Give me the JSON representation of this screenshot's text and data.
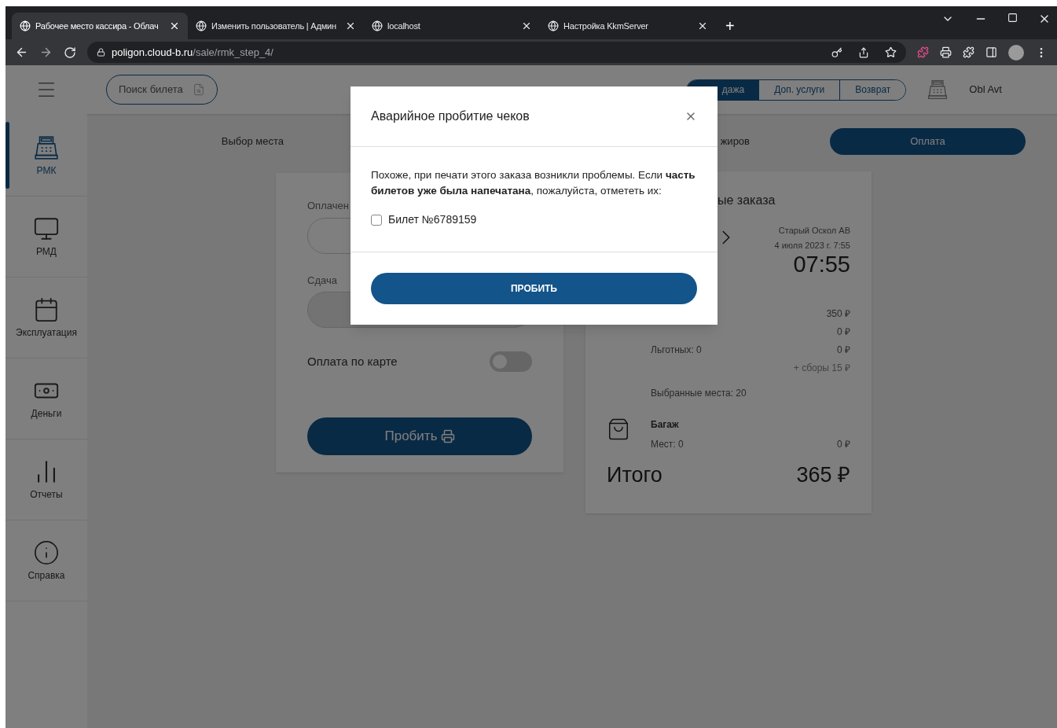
{
  "browser": {
    "tabs": [
      {
        "title": "Рабочее место кассира - Облач",
        "selected": true
      },
      {
        "title": "Изменить пользователь | Админ",
        "selected": false
      },
      {
        "title": "localhost",
        "selected": false
      },
      {
        "title": "Настройка KkmServer",
        "selected": false
      }
    ],
    "new_tab": "+",
    "url_host": "poligon.cloud-b.ru",
    "url_path": "/sale/rmk_step_4/"
  },
  "header": {
    "search_button": "Поиск билета",
    "modes": [
      {
        "label": "дажа",
        "selected": true
      },
      {
        "label": "Доп. услуги",
        "selected": false
      },
      {
        "label": "Возврат",
        "selected": false
      }
    ],
    "user": "Obl Avt"
  },
  "sidebar": {
    "items": [
      {
        "label": "РМК",
        "kind": "register",
        "selected": true
      },
      {
        "label": "РМД",
        "kind": "monitor",
        "selected": false
      },
      {
        "label": "Эксплуатация",
        "kind": "calendar",
        "selected": false
      },
      {
        "label": "Деньги",
        "kind": "money",
        "selected": false
      },
      {
        "label": "Отчеты",
        "kind": "chart",
        "selected": false
      },
      {
        "label": "Справка",
        "kind": "info",
        "selected": false
      }
    ]
  },
  "steps": [
    {
      "label": "Выбор места",
      "selected": false
    },
    {
      "label": "жиров",
      "selected": false
    },
    {
      "label": "Оплата",
      "selected": true
    }
  ],
  "payment": {
    "paid_label": "Оплачен",
    "change_label": "Сдача",
    "card_label": "Оплата по карте",
    "card_payment_on": false,
    "submit": "Пробить"
  },
  "order": {
    "title": "ые заказа",
    "station": "Старый Оскол АВ",
    "departure": "4 июля 2023 г. 7:55",
    "time": "07:55",
    "lines": [
      {
        "amount": "350 ₽"
      },
      {
        "amount": "0 ₽"
      },
      {
        "label": "Льготных: 0",
        "amount": "0 ₽"
      }
    ],
    "fees": "+ сборы 15 ₽",
    "seats": "Выбранные места: 20",
    "baggage": {
      "title": "Багаж",
      "count": "Мест: 0",
      "amount": "0 ₽"
    },
    "total_label": "Итого",
    "total": "365 ₽"
  },
  "dialog": {
    "title": "Аварийное пробитие чеков",
    "message": "Похоже, при печати этого заказа возникли проблемы. Если **часть билетов уже была напечатана**, пожалуйста, отмететь их:",
    "tickets": [
      {
        "label": "Билет №6789159",
        "checked": false
      }
    ],
    "submit": "ПРОБИТЬ"
  }
}
